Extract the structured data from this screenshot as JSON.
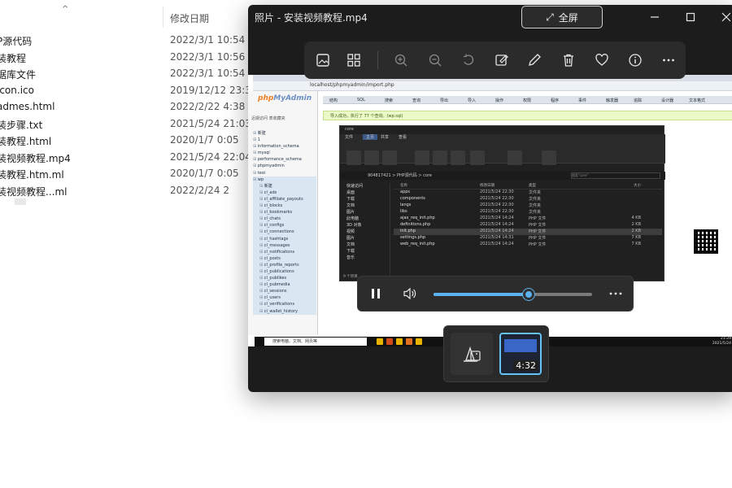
{
  "explorer": {
    "column_date": "修改日期",
    "files": [
      {
        "name": "P源代码",
        "date": "2022/3/1 10:54"
      },
      {
        "name": "装教程",
        "date": "2022/3/1 10:56"
      },
      {
        "name": "据库文件",
        "date": "2022/3/1 10:54"
      },
      {
        "name": "icon.ico",
        "date": "2019/12/12 23:38"
      },
      {
        "name": "admes.html",
        "date": "2022/2/22 4:38"
      },
      {
        "name": "装步骤.txt",
        "date": "2021/5/24 21:03"
      },
      {
        "name": "装教程.html",
        "date": "2020/1/7 0:05"
      },
      {
        "name": "装视频教程.mp4",
        "date": "2021/5/24 22:04"
      },
      {
        "name": "装教程.htm.ml",
        "date": "2020/1/7 0:05"
      },
      {
        "name": "装视频教程...ml",
        "date": "2022/2/24 2"
      }
    ]
  },
  "photos": {
    "title": "照片 - 安装视频教程.mp4",
    "fullscreen_label": "全屏",
    "playback_progress": 0.6,
    "duration": "4:32"
  },
  "video": {
    "address": "localhost/phpmyadmin/import.php",
    "pma_logo_a": "php",
    "pma_logo_b": "MyAdmin",
    "pma_sub": "近期访问 表收藏夹",
    "pma_tree": [
      "新建",
      "1",
      "information_schema",
      "mysql",
      "performance_schema",
      "phpmyadmin",
      "test",
      "wp",
      "新建",
      "cl_ads",
      "cl_affiliate_payouts",
      "cl_blocks",
      "cl_bookmarks",
      "cl_chats",
      "cl_configs",
      "cl_connections",
      "cl_hashtags",
      "cl_messages",
      "cl_notifications",
      "cl_posts",
      "cl_profile_reports",
      "cl_publications",
      "cl_publikes",
      "cl_pubmedia",
      "cl_sessions",
      "cl_users",
      "cl_verifications",
      "cl_wallet_history"
    ],
    "pma_tabs": [
      "结构",
      "SQL",
      "搜索",
      "查询",
      "导出",
      "导入",
      "操作",
      "权限",
      "程序",
      "事件",
      "触发器",
      "追踪",
      "设计器",
      "文本格式"
    ],
    "pma_success": "导入成功，执行了 77 个查询。(wp.sql)",
    "inner": {
      "title": "core",
      "ribbon_tabs": [
        "文件",
        "主页",
        "共享",
        "查看"
      ],
      "path": "904817421 > PHP源代码 > core",
      "search_placeholder": "搜索\"core\"",
      "nav": [
        "快速访问",
        "桌面",
        "下载",
        "文档",
        "图片",
        "此电脑",
        "3D 对象",
        "视频",
        "图片",
        "文档",
        "下载",
        "音乐"
      ],
      "headers": {
        "name": "名称",
        "date": "修改日期",
        "type": "类型",
        "size": "大小"
      },
      "rows": [
        {
          "name": "apps",
          "date": "2021/5/24 22:30",
          "type": "文件夹",
          "size": ""
        },
        {
          "name": "components",
          "date": "2021/5/24 22:30",
          "type": "文件夹",
          "size": ""
        },
        {
          "name": "langs",
          "date": "2021/5/24 22:30",
          "type": "文件夹",
          "size": ""
        },
        {
          "name": "libs",
          "date": "2021/5/24 22:30",
          "type": "文件夹",
          "size": ""
        },
        {
          "name": "ajax_req_init.php",
          "date": "2021/5/24 14:24",
          "type": "PHP 文件",
          "size": "4 KB"
        },
        {
          "name": "definitions.php",
          "date": "2021/5/24 14:24",
          "type": "PHP 文件",
          "size": "2 KB"
        },
        {
          "name": "init.php",
          "date": "2021/5/24 14:24",
          "type": "PHP 文件",
          "size": "2 KB"
        },
        {
          "name": "settings.php",
          "date": "2021/5/24 14:31",
          "type": "PHP 文件",
          "size": "7 KB"
        },
        {
          "name": "web_req_init.php",
          "date": "2021/5/24 14:24",
          "type": "PHP 文件",
          "size": "7 KB"
        }
      ],
      "status": "9 个项目"
    },
    "taskbar_search": "搜索电脑、文档、网页等",
    "clock_time": "21:29",
    "clock_date": "2021/5/24"
  },
  "colors": {
    "accent": "#5ab3ef",
    "window_bg": "#1c1c1c",
    "toolbar_bg": "#2b2b2b"
  }
}
